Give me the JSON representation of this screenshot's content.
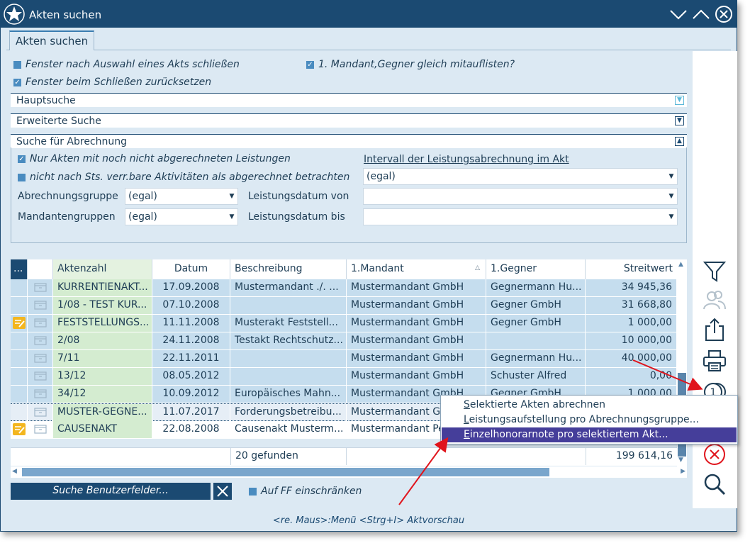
{
  "window": {
    "title": "Akten suchen"
  },
  "tab": {
    "label": "Akten suchen"
  },
  "options": {
    "close_after_select": "Fenster nach Auswahl eines Akts schließen",
    "reset_on_close": "Fenster beim Schließen zurücksetzen",
    "list_client_opponent": "1. Mandant,Gegner gleich mitauflisten?"
  },
  "sections": {
    "main": "Hauptsuche",
    "extended": "Erweiterte Suche",
    "billing": "Suche für Abrechnung"
  },
  "billing": {
    "only_unbilled": "Nur Akten mit noch nicht abgerechneten Leistungen",
    "not_by_sts": "nicht nach Sts. verr.bare Aktivitäten als abgerechnet betrachten",
    "interval_link": "Intervall der Leistungsabrechnung im Akt",
    "interval_value": "(egal)",
    "group_label": "Abrechnungsgruppe",
    "group_value": "(egal)",
    "client_groups_label": "Mandantengruppen",
    "client_groups_value": "(egal)",
    "date_from_label": "Leistungsdatum von",
    "date_to_label": "Leistungsdatum bis",
    "date_from_value": "",
    "date_to_value": ""
  },
  "table": {
    "menu_button": "...",
    "columns": [
      "Aktenzahl",
      "Datum",
      "Beschreibung",
      "1.Mandant",
      "1.Gegner",
      "Streitwert"
    ],
    "rows": [
      {
        "az": "KURRENTIENAKT...",
        "datum": "17.09.2008",
        "besch": "Mustermandant ./. ...",
        "mand": "Mustermandant GmbH",
        "gegner": "Gegnermann Hu...",
        "wert": "34 945,36",
        "note": false
      },
      {
        "az": "1/08 - TEST KUR...",
        "datum": "07.10.2008",
        "besch": "",
        "mand": "Mustermandant GmbH",
        "gegner": "Gegner GmbH",
        "wert": "31 668,80",
        "note": false
      },
      {
        "az": "FESTSTELLUNGS...",
        "datum": "11.11.2008",
        "besch": "Musterakt Feststell...",
        "mand": "Mustermandant GmbH",
        "gegner": "Gegner GmbH",
        "wert": "1 000,00",
        "note": true
      },
      {
        "az": "2/08",
        "datum": "24.11.2008",
        "besch": "Testakt Rechtschutz...",
        "mand": "Mustermandant GmbH",
        "gegner": "",
        "wert": "10 000,00",
        "note": false
      },
      {
        "az": "7/11",
        "datum": "22.11.2011",
        "besch": "",
        "mand": "Mustermandant GmbH",
        "gegner": "Gegnermann Hu...",
        "wert": "40 000,00",
        "note": false
      },
      {
        "az": "13/12",
        "datum": "08.05.2012",
        "besch": "",
        "mand": "Mustermandant GmbH",
        "gegner": "Schuster Alfred",
        "wert": "0,00",
        "note": false
      },
      {
        "az": "34/12",
        "datum": "10.09.2012",
        "besch": "Europäisches Mahn...",
        "mand": "Mustermandant GmbH",
        "gegner": "Gegner GmbH",
        "wert": "1 000,00",
        "note": false
      },
      {
        "az": "MUSTER-GEGNE...",
        "datum": "11.07.2017",
        "besch": "Forderungsbetreibu...",
        "mand": "Mustermandant G",
        "gegner": "",
        "wert": "",
        "note": false
      },
      {
        "az": "CAUSENAKT",
        "datum": "22.08.2008",
        "besch": "Causenakt Musterm...",
        "mand": "Mustermandant Pe",
        "gegner": "",
        "wert": "",
        "note": true
      }
    ],
    "footer_count": "20 gefunden",
    "footer_sum": "199 614,16"
  },
  "bottom": {
    "search_custom": "Suche Benutzerfelder...",
    "restrict_ff": "Auf FF einschränken",
    "hint": "<re. Maus>:Menü  <Strg+I> Aktvorschau"
  },
  "context_menu": {
    "items": [
      {
        "label": "Selektierte Akten abrechnen",
        "highlighted": false
      },
      {
        "label": "Leistungsaufstellung pro Abrechnungsgruppe...",
        "highlighted": false
      },
      {
        "label": "Einzelhonorarnote pro selektiertem Akt...",
        "highlighted": true
      }
    ]
  },
  "sidebar_icons": [
    "filter-icon",
    "users-icon",
    "share-icon",
    "print-icon",
    "billing-icon",
    "cancel-icon",
    "search-icon"
  ],
  "colors": {
    "titlebar": "#1b4a72",
    "background": "#dce9f3",
    "accent": "#453e9a",
    "arrow": "#e0141c"
  }
}
